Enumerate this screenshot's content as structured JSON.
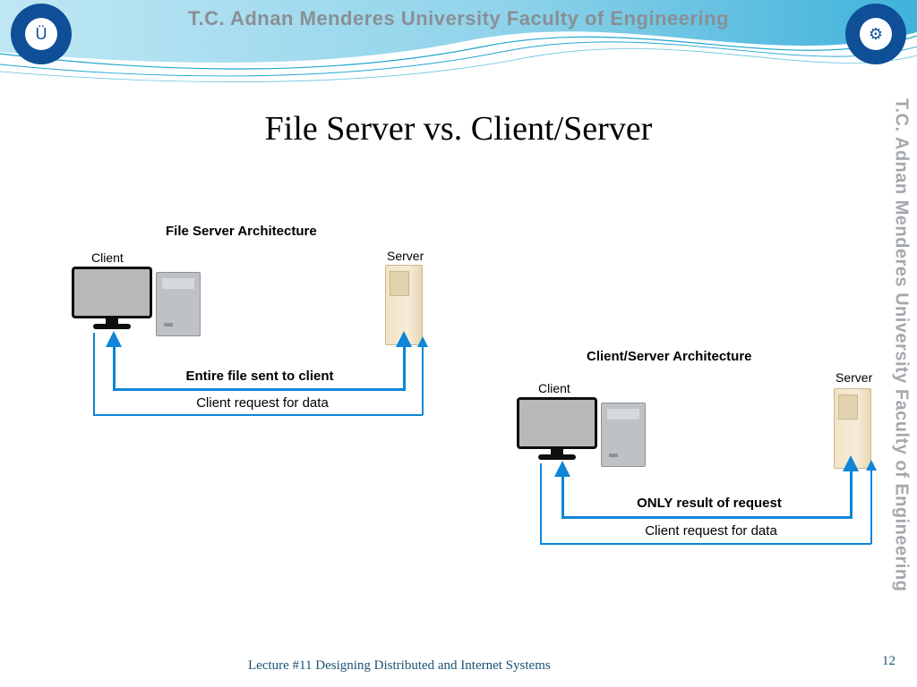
{
  "header": {
    "text": "T.C.    Adnan Menderes University    Faculty of Engineering"
  },
  "side_text": "T.C.   Adnan Menderes University   Faculty of Engineering",
  "slide": {
    "title": "File Server vs. Client/Server",
    "footer": "Lecture #11 Designing Distributed and Internet Systems",
    "page": "12"
  },
  "labels": {
    "client": "Client",
    "server": "Server"
  },
  "diagram1": {
    "title": "File Server Architecture",
    "flow_top": "Entire file sent to client",
    "flow_bottom": "Client request for data"
  },
  "diagram2": {
    "title": "Client/Server Architecture",
    "flow_top": "ONLY result of request",
    "flow_bottom": "Client request for data"
  },
  "icons": {
    "logo_left": "university-crest-icon",
    "logo_right": "faculty-crest-icon"
  }
}
